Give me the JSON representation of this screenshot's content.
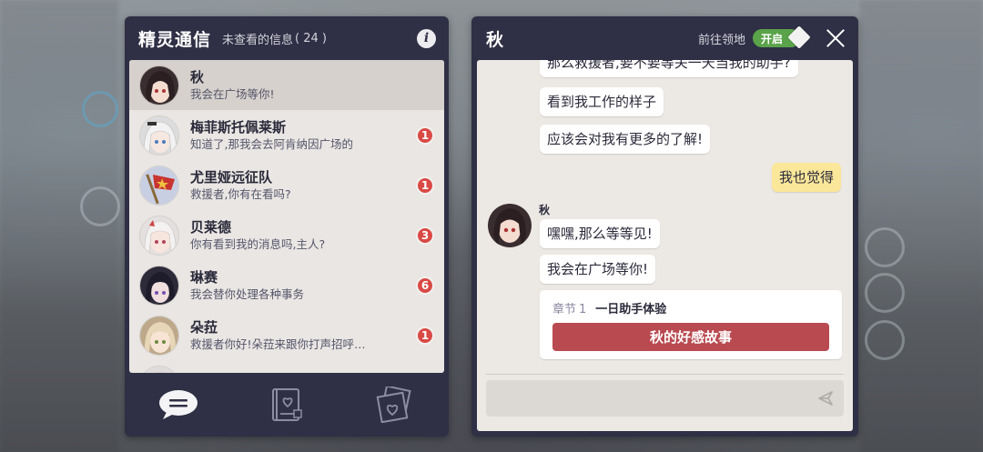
{
  "left_panel": {
    "title": "精灵通信",
    "unread_label": "未查看的信息",
    "unread_count": "( 24 )",
    "info_icon": "i",
    "contacts": [
      {
        "name": "秋",
        "message": "我会在广场等你!",
        "badge": "",
        "selected": true
      },
      {
        "name": "梅菲斯托佩莱斯",
        "message": "知道了,那我会去阿肯纳因广场的",
        "badge": "1"
      },
      {
        "name": "尤里娅远征队",
        "message": "救援者,你有在看吗?",
        "badge": "1"
      },
      {
        "name": "贝莱德",
        "message": "你有看到我的消息吗,主人?",
        "badge": "3"
      },
      {
        "name": "琳赛",
        "message": "我会替你处理各种事务",
        "badge": "6"
      },
      {
        "name": "朵菈",
        "message": "救援者你好!朵菈来跟你打声招呼…",
        "badge": "1"
      },
      {
        "name": "",
        "message": "",
        "badge": ""
      }
    ],
    "tabs": [
      {
        "icon": "chat-bubble-icon",
        "active": true
      },
      {
        "icon": "heart-book-icon",
        "active": false
      },
      {
        "icon": "heart-photos-icon",
        "active": false
      }
    ]
  },
  "chat": {
    "title": "秋",
    "goto_label": "前往领地",
    "toggle_label": "开启",
    "messages": [
      {
        "from": "other",
        "text": "那么救援者,要不要等关一天当我的助手?"
      },
      {
        "from": "other",
        "text": "看到我工作的样子"
      },
      {
        "from": "other",
        "text": "应该会对我有更多的了解!"
      },
      {
        "from": "me",
        "text": "我也觉得"
      },
      {
        "from": "other",
        "text": "嘿嘿,那么等等见!"
      },
      {
        "from": "other",
        "text": "我会在广场等你!"
      }
    ],
    "sender_name": "秋",
    "chapter": {
      "tag": "章节",
      "number": "1",
      "title": "一日助手体验",
      "button_label": "秋的好感故事"
    }
  },
  "colors": {
    "panel_bg": "#2f2f45",
    "list_bg": "#e9e6e3",
    "badge": "#d94a45",
    "toggle_on": "#5aa34a",
    "mine_bubble": "#fbe79a",
    "story_button": "#b94a50"
  }
}
